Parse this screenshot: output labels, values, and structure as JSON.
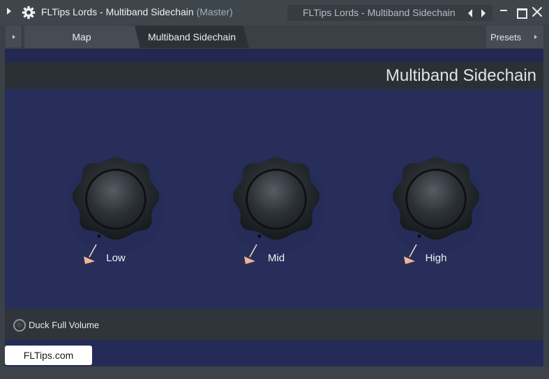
{
  "window": {
    "title": "FLTips Lords - Multiband Sidechain",
    "title_suffix": "(Master)",
    "nav_title": "FLTips Lords - Multiband Sidechain",
    "icons": [
      "gear-icon",
      "chevron-left-icon",
      "chevron-right-icon",
      "minimize-icon",
      "maximize-icon",
      "close-icon"
    ]
  },
  "tabs": [
    {
      "label": "Map",
      "active": false
    },
    {
      "label": "Multiband Sidechain",
      "active": true
    }
  ],
  "presets_label": "Presets",
  "plugin": {
    "title": "Multiband Sidechain",
    "knobs": [
      {
        "label": "Low"
      },
      {
        "label": "Mid"
      },
      {
        "label": "High"
      }
    ],
    "duck_label": "Duck Full Volume"
  },
  "watermark": "FLTips.com",
  "colors": {
    "plugin_bg": "#272e5a",
    "accent_marker": "#f4b393",
    "titlebar": "#3e454b"
  }
}
